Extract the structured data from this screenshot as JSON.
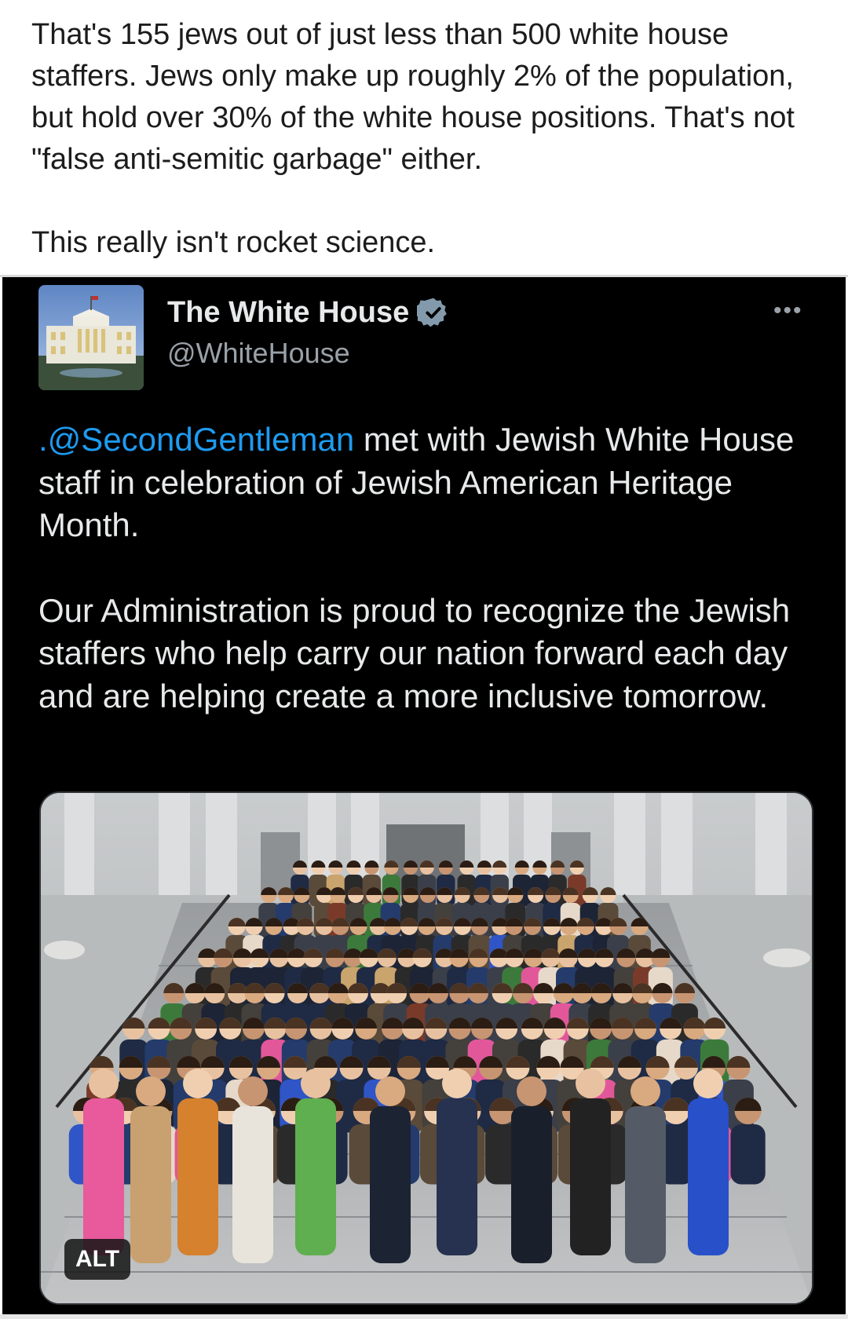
{
  "comment": {
    "paragraph1": "That's 155 jews out of just less than 500 white house staffers. Jews only make up roughly 2% of the population, but hold over 30% of the white house positions. That's not \"false anti-semitic garbage\" either.",
    "paragraph2": "This really isn't rocket science."
  },
  "tweet": {
    "display_name": "The White House",
    "handle": "@WhiteHouse",
    "verified": true,
    "more_icon": "more-horizontal-icon",
    "mention": ".@SecondGentleman",
    "text_after_mention": " met with Jewish White House staff in celebration of Jewish American Heritage Month.",
    "paragraph2": "Our Administration is proud to recognize the Jewish staffers who help carry our nation forward each day and are helping create a more inclusive tomorrow.",
    "photo": {
      "alt_badge": "ALT"
    }
  },
  "colors": {
    "tweet_bg": "#000000",
    "mention": "#1d9bf0",
    "verified_badge": "#829aab",
    "handle": "#9aa1a8"
  }
}
